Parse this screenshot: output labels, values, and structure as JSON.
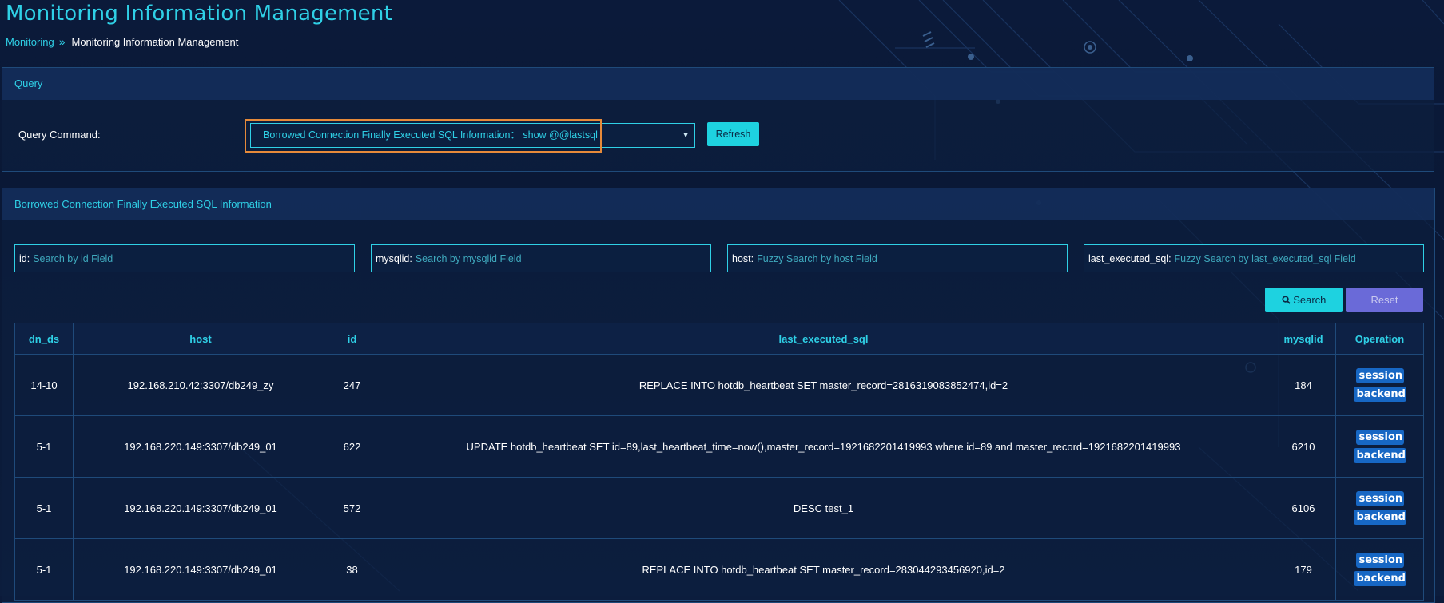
{
  "page": {
    "title": "Monitoring Information Management",
    "breadcrumb": {
      "parent": "Monitoring",
      "separator": "»",
      "current": "Monitoring Information Management"
    }
  },
  "query_panel": {
    "title": "Query",
    "command_label": "Query Command:",
    "selected_command": "Borrowed Connection Finally Executed SQL Information：  show @@lastsql",
    "caret_icon": "caret-down-icon",
    "refresh_label": "Refresh"
  },
  "info_panel": {
    "title": "Borrowed Connection Finally Executed SQL Information",
    "filters": [
      {
        "label": "id:",
        "placeholder": "Search by id Field"
      },
      {
        "label": "mysqlid:",
        "placeholder": "Search by mysqlid Field"
      },
      {
        "label": "host:",
        "placeholder": "Fuzzy Search by host Field"
      },
      {
        "label": "last_executed_sql:",
        "placeholder": "Fuzzy Search by last_executed_sql Field"
      }
    ],
    "search_label": "Search",
    "search_icon": "search-icon",
    "reset_label": "Reset",
    "table": {
      "columns": [
        "dn_ds",
        "host",
        "id",
        "last_executed_sql",
        "mysqlid",
        "Operation"
      ],
      "rows": [
        {
          "dn_ds": "14-10",
          "host": "192.168.210.42:3307/db249_zy",
          "id": "247",
          "sql": "REPLACE INTO hotdb_heartbeat SET master_record=2816319083852474,id=2",
          "mysqlid": "184"
        },
        {
          "dn_ds": "5-1",
          "host": "192.168.220.149:3307/db249_01",
          "id": "622",
          "sql": "UPDATE hotdb_heartbeat SET id=89,last_heartbeat_time=now(),master_record=1921682201419993 where id=89 and master_record=1921682201419993",
          "mysqlid": "6210"
        },
        {
          "dn_ds": "5-1",
          "host": "192.168.220.149:3307/db249_01",
          "id": "572",
          "sql": "DESC test_1",
          "mysqlid": "6106"
        },
        {
          "dn_ds": "5-1",
          "host": "192.168.220.149:3307/db249_01",
          "id": "38",
          "sql": "REPLACE INTO hotdb_heartbeat SET master_record=283044293456920,id=2",
          "mysqlid": "179"
        }
      ],
      "operations": {
        "session": "session",
        "backend": "backend"
      }
    }
  },
  "colors": {
    "accent": "#2fd0e6",
    "background": "#0b1a3a",
    "button": "#1ed2e0",
    "reset": "#6a6ad8",
    "op_button": "#1767c4",
    "highlight": "#e68a3a"
  }
}
